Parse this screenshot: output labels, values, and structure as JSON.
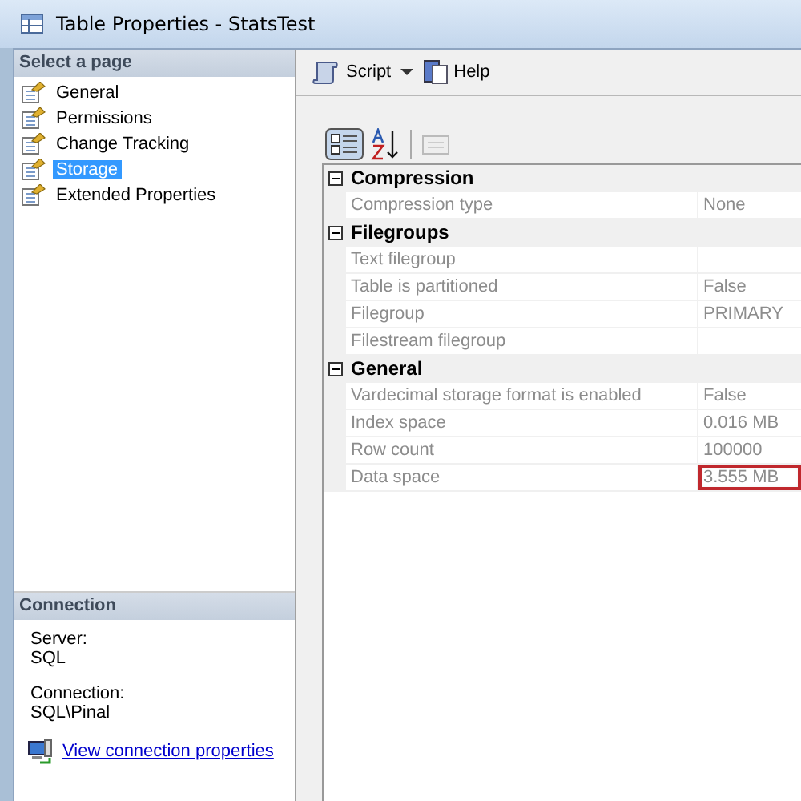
{
  "window": {
    "title": "Table Properties - StatsTest"
  },
  "sidebar": {
    "header": "Select a page",
    "items": [
      {
        "label": "General",
        "selected": false
      },
      {
        "label": "Permissions",
        "selected": false
      },
      {
        "label": "Change Tracking",
        "selected": false
      },
      {
        "label": "Storage",
        "selected": true
      },
      {
        "label": "Extended Properties",
        "selected": false
      }
    ]
  },
  "connection": {
    "header": "Connection",
    "fields": [
      {
        "label": "Server:",
        "value": "SQL"
      },
      {
        "label": "Connection:",
        "value": "SQL\\Pinal"
      }
    ],
    "link": "View connection properties"
  },
  "toolbar": {
    "script": "Script",
    "help": "Help"
  },
  "grid": {
    "categories": [
      {
        "name": "Compression",
        "expanded": true,
        "rows": [
          {
            "name": "Compression type",
            "value": "None"
          }
        ]
      },
      {
        "name": "Filegroups",
        "expanded": true,
        "rows": [
          {
            "name": "Text filegroup"
          },
          {
            "name": "Table is partitioned",
            "value": "False"
          },
          {
            "name": "Filegroup",
            "value": "PRIMARY"
          },
          {
            "name": "Filestream filegroup"
          }
        ]
      },
      {
        "name": "General",
        "expanded": true,
        "rows": [
          {
            "name": "Vardecimal storage format is enabled",
            "value": "False"
          },
          {
            "name": "Index space",
            "value": "0.016 MB"
          },
          {
            "name": "Row count",
            "value": "100000"
          },
          {
            "name": "Data space",
            "value": "3.555 MB",
            "highlighted": true
          }
        ]
      }
    ]
  }
}
